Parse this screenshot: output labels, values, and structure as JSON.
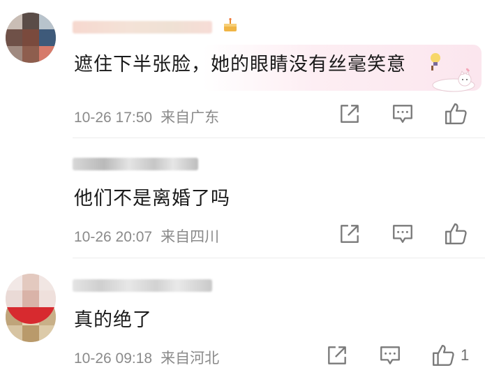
{
  "comments": [
    {
      "text": "遮住下半张脸，她的眼睛没有丝毫笑意",
      "time": "10-26 17:50",
      "location": "来自广东",
      "likes": ""
    },
    {
      "text": "他们不是离婚了吗",
      "time": "10-26 20:07",
      "location": "来自四川",
      "likes": ""
    },
    {
      "text": "真的绝了",
      "time": "10-26 09:18",
      "location": "来自河北",
      "likes": "1"
    }
  ],
  "icons": {
    "share": "share-icon",
    "reply": "comment-icon",
    "like": "thumbs-up-icon",
    "badge": "cake-badge-icon"
  },
  "colors": {
    "text": "#1a1a1a",
    "meta": "#8a8a8a",
    "icon": "#7a7a7a",
    "bubble": "#fbe6ee"
  }
}
